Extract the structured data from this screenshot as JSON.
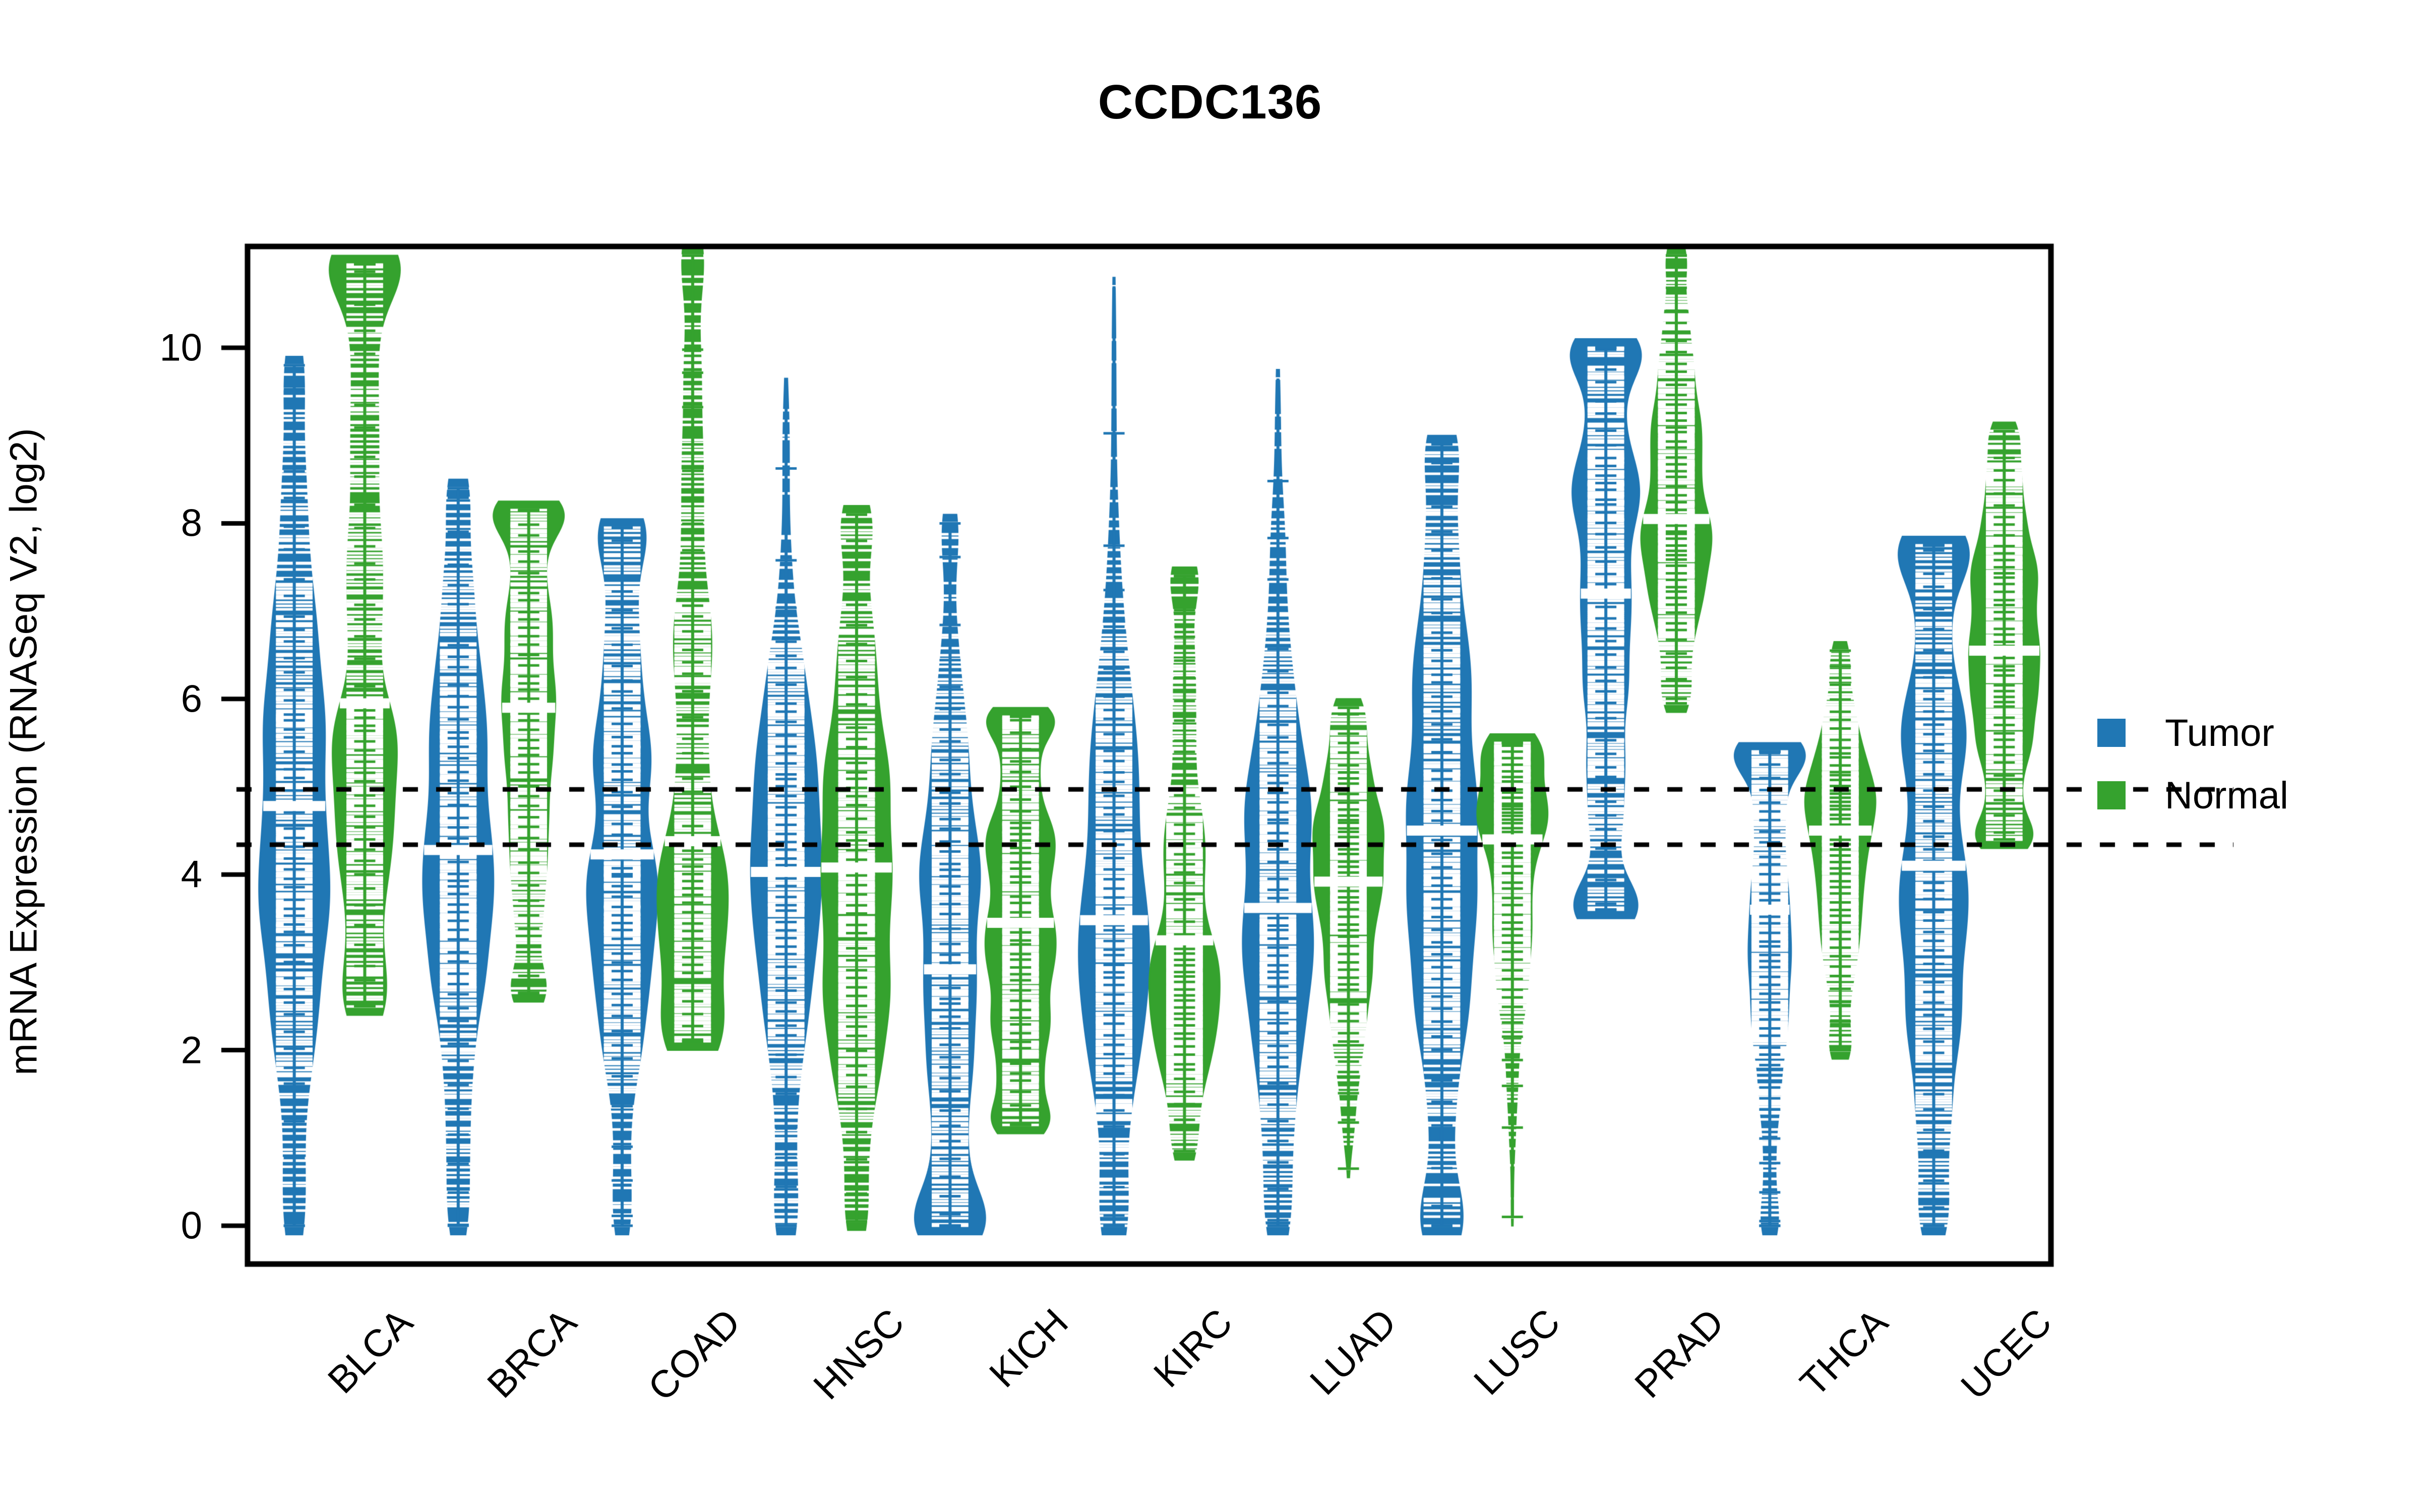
{
  "chart_data": {
    "type": "violin",
    "title": "CCDC136",
    "xlabel": "",
    "ylabel": "mRNA Expression (RNASeq V2, log2)",
    "ylim": [
      -0.55,
      11.2
    ],
    "yticks": [
      0,
      2,
      4,
      6,
      8,
      10
    ],
    "ytick_labels": [
      "0",
      "2",
      "4",
      "6",
      "8",
      "10"
    ],
    "grid": false,
    "legend_position": "right",
    "reference_lines": [
      4.97,
      4.34
    ],
    "categories": [
      "BLCA",
      "BRCA",
      "COAD",
      "HNSC",
      "KICH",
      "KIRC",
      "LUAD",
      "LUSC",
      "PRAD",
      "THCA",
      "UCEC"
    ],
    "series": [
      {
        "name": "Tumor",
        "color": "#2077B4",
        "medians": [
          4.78,
          4.28,
          4.23,
          4.03,
          2.92,
          3.48,
          3.62,
          4.5,
          7.2,
          3.6,
          4.1
        ],
        "mins": [
          0.0,
          0.0,
          0.0,
          0.0,
          0.0,
          0.0,
          0.0,
          0.0,
          3.6,
          0.0,
          0.0
        ],
        "maxs": [
          9.8,
          8.4,
          7.95,
          9.55,
          8.0,
          10.7,
          9.65,
          8.9,
          10.0,
          5.4,
          7.75
        ],
        "q_low": [
          3.25,
          2.85,
          2.9,
          2.6,
          1.0,
          2.15,
          2.3,
          2.6,
          5.2,
          2.3,
          2.55
        ],
        "q_high": [
          6.55,
          5.75,
          6.1,
          5.25,
          4.6,
          5.05,
          5.1,
          6.2,
          8.75,
          5.0,
          6.1
        ]
      },
      {
        "name": "Normal",
        "color": "#35A22E",
        "medians": [
          5.95,
          5.9,
          4.38,
          4.08,
          3.45,
          3.25,
          3.92,
          4.4,
          8.05,
          4.5,
          6.55
        ],
        "mins": [
          2.5,
          2.65,
          2.1,
          0.05,
          1.15,
          0.85,
          0.65,
          0.1,
          5.95,
          2.0,
          4.4
        ],
        "maxs": [
          10.95,
          8.15,
          11.05,
          8.1,
          5.8,
          7.4,
          5.9,
          5.5,
          11.05,
          6.55,
          9.05
        ],
        "q_low": [
          4.45,
          4.4,
          3.3,
          2.6,
          2.4,
          2.35,
          3.0,
          3.3,
          7.3,
          3.55,
          5.55
        ],
        "q_high": [
          9.3,
          7.2,
          7.1,
          5.55,
          4.6,
          4.95,
          4.7,
          4.95,
          9.2,
          5.15,
          7.55
        ]
      }
    ]
  },
  "title": {
    "text": "CCDC136"
  },
  "axes": {
    "y_title": "mRNA Expression (RNASeq V2, log2)",
    "y_ticks": [
      {
        "label": "10",
        "value": 10
      },
      {
        "label": "8",
        "value": 8
      },
      {
        "label": "6",
        "value": 6
      },
      {
        "label": "4",
        "value": 4
      },
      {
        "label": "2",
        "value": 2
      },
      {
        "label": "0",
        "value": 0
      }
    ],
    "x_ticks": [
      {
        "label": "BLCA"
      },
      {
        "label": "BRCA"
      },
      {
        "label": "COAD"
      },
      {
        "label": "HNSC"
      },
      {
        "label": "KICH"
      },
      {
        "label": "KIRC"
      },
      {
        "label": "LUAD"
      },
      {
        "label": "LUSC"
      },
      {
        "label": "PRAD"
      },
      {
        "label": "THCA"
      },
      {
        "label": "UCEC"
      }
    ]
  },
  "legend": {
    "items": [
      {
        "label": "Tumor",
        "color": "#2077B4"
      },
      {
        "label": "Normal",
        "color": "#35A22E"
      }
    ]
  },
  "colors": {
    "tumor": "#2077B4",
    "normal": "#35A22E",
    "axis": "#000000",
    "background": "#FFFFFF"
  }
}
